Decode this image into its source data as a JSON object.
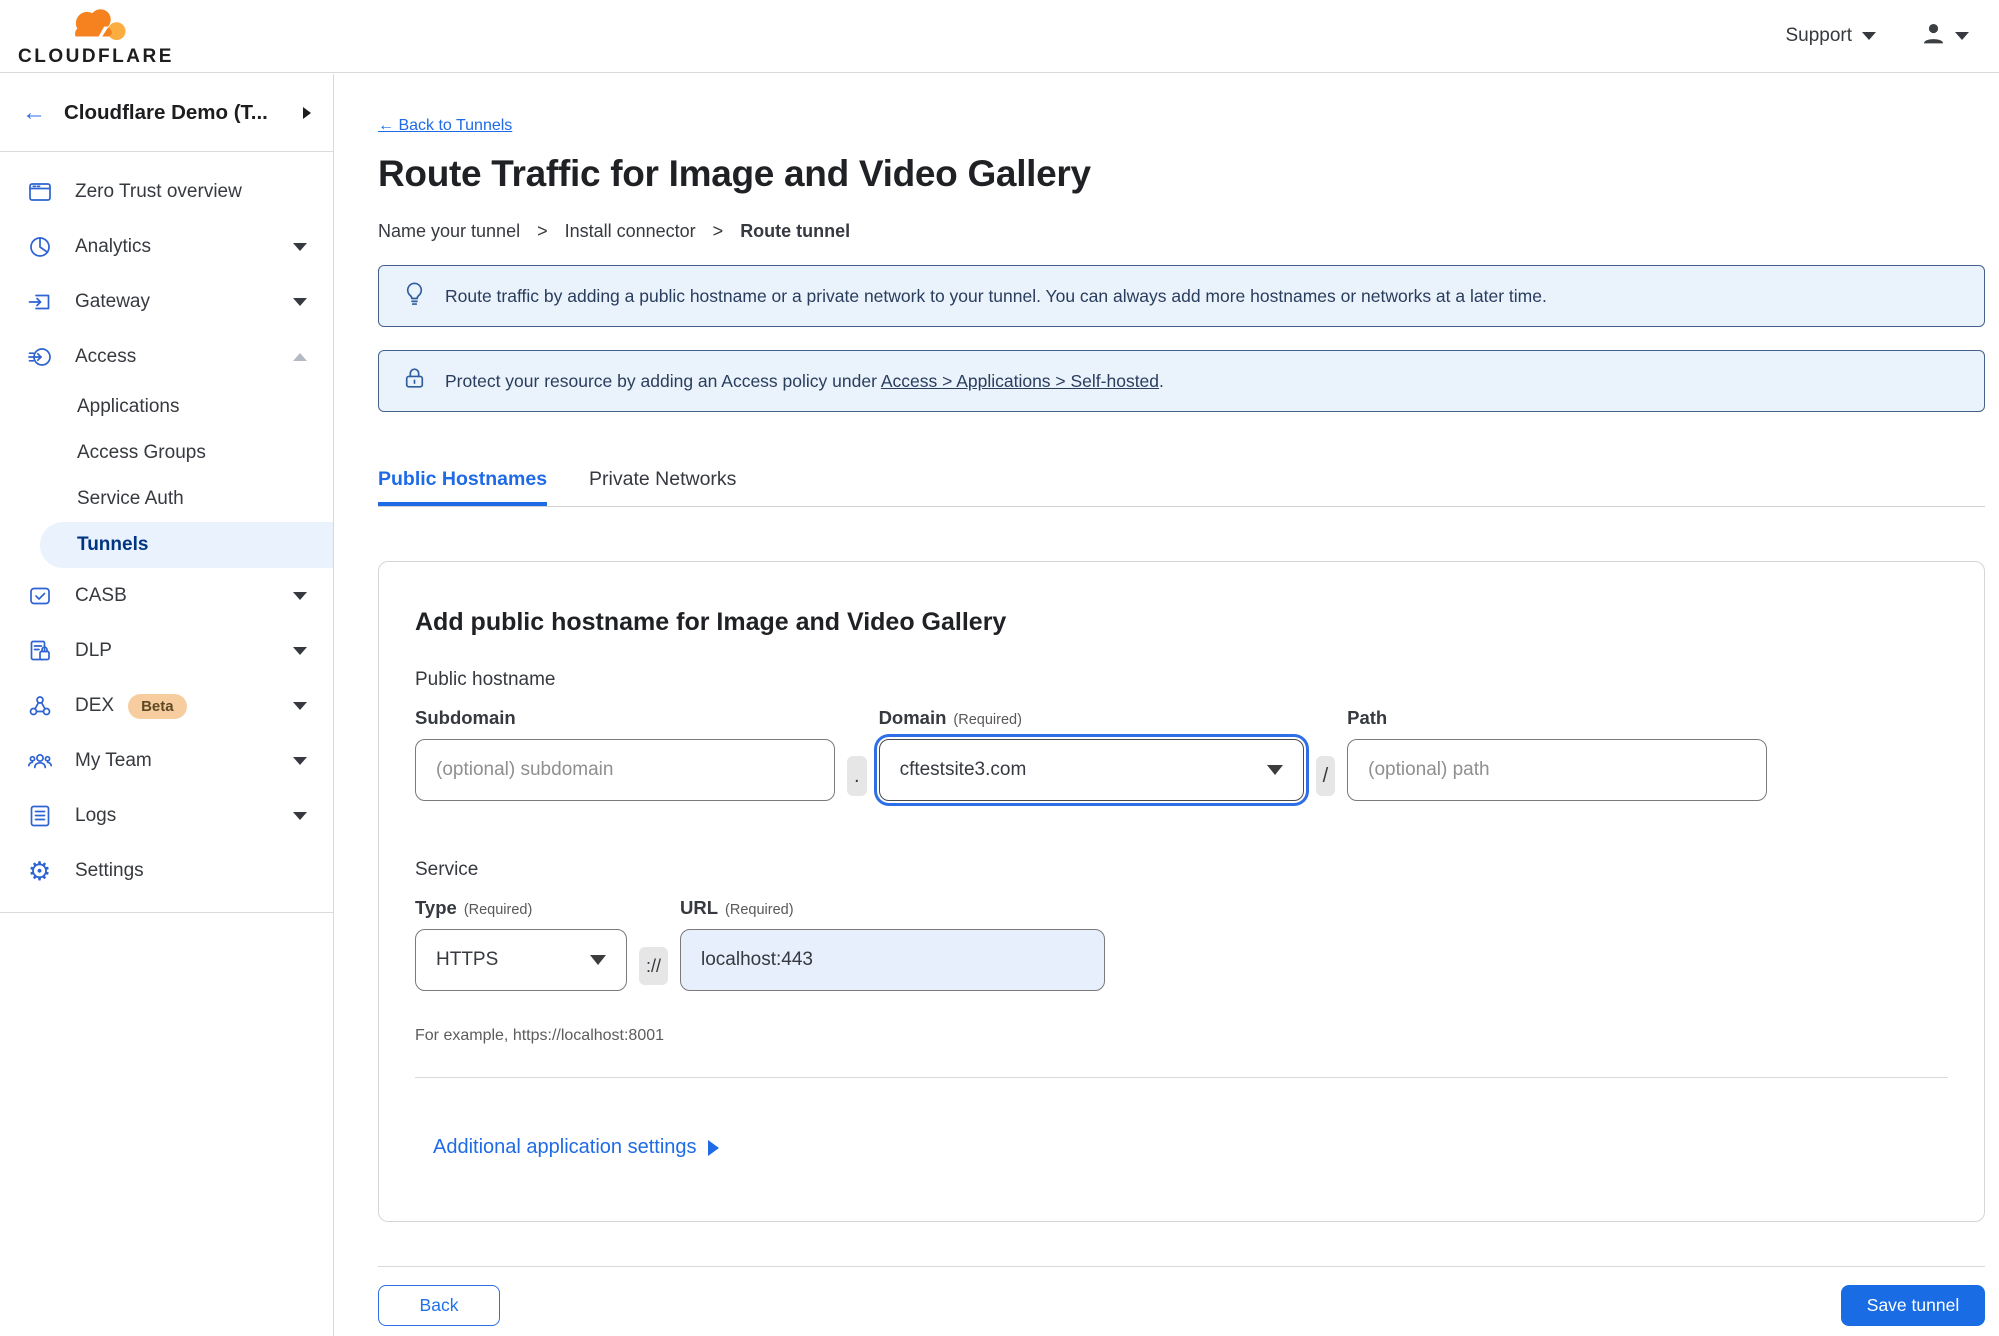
{
  "topbar": {
    "brand": "CLOUDFLARE",
    "support_label": "Support"
  },
  "sidebar": {
    "account_name": "Cloudflare Demo (T...",
    "items": [
      {
        "label": "Zero Trust overview"
      },
      {
        "label": "Analytics"
      },
      {
        "label": "Gateway"
      },
      {
        "label": "Access"
      },
      {
        "label": "CASB"
      },
      {
        "label": "DLP"
      },
      {
        "label": "DEX",
        "badge": "Beta"
      },
      {
        "label": "My Team"
      },
      {
        "label": "Logs"
      },
      {
        "label": "Settings"
      }
    ],
    "access_children": [
      {
        "label": "Applications"
      },
      {
        "label": "Access Groups"
      },
      {
        "label": "Service Auth"
      },
      {
        "label": "Tunnels"
      }
    ]
  },
  "main": {
    "back_link": "← Back to Tunnels",
    "title": "Route Traffic for Image and Video Gallery",
    "steps": [
      "Name your tunnel",
      "Install connector",
      "Route tunnel"
    ],
    "steps_separator": ">",
    "banners": [
      {
        "text": "Route traffic by adding a public hostname or a private network to your tunnel. You can always add more hostnames or networks at a later time."
      },
      {
        "text_prefix": "Protect your resource by adding an Access policy under ",
        "link": "Access > Applications > Self-hosted",
        "suffix": "."
      }
    ],
    "tabs": [
      {
        "label": "Public Hostnames"
      },
      {
        "label": "Private Networks"
      }
    ],
    "form": {
      "heading": "Add public hostname for Image and Video Gallery",
      "public_hostname_label": "Public hostname",
      "subdomain": {
        "label": "Subdomain",
        "placeholder": "(optional) subdomain"
      },
      "dot_separator": ".",
      "domain": {
        "label": "Domain",
        "required_note": "(Required)",
        "value": "cftestsite3.com"
      },
      "slash_separator": "/",
      "path": {
        "label": "Path",
        "placeholder": "(optional) path"
      },
      "service_label": "Service",
      "type": {
        "label": "Type",
        "required_note": "(Required)",
        "value": "HTTPS"
      },
      "scheme_separator": "://",
      "url": {
        "label": "URL",
        "required_note": "(Required)",
        "value": "localhost:443"
      },
      "example_text": "For example, https://localhost:8001",
      "additional_settings_label": "Additional application settings"
    },
    "footer": {
      "back_label": "Back",
      "save_label": "Save tunnel"
    }
  },
  "colors": {
    "accent_blue": "#1f6ae5",
    "sidebar_icon_blue": "#2d63d2",
    "active_item_text": "#003681",
    "active_item_bg": "#e9f2fd",
    "banner_bg": "#eaf2fc",
    "banner_border": "#44618c",
    "brand_orange": "#f6821f",
    "brand_orange_light": "#fbad41",
    "beta_badge_bg": "#f7cda0",
    "url_autofill_bg": "#e7eefc"
  }
}
